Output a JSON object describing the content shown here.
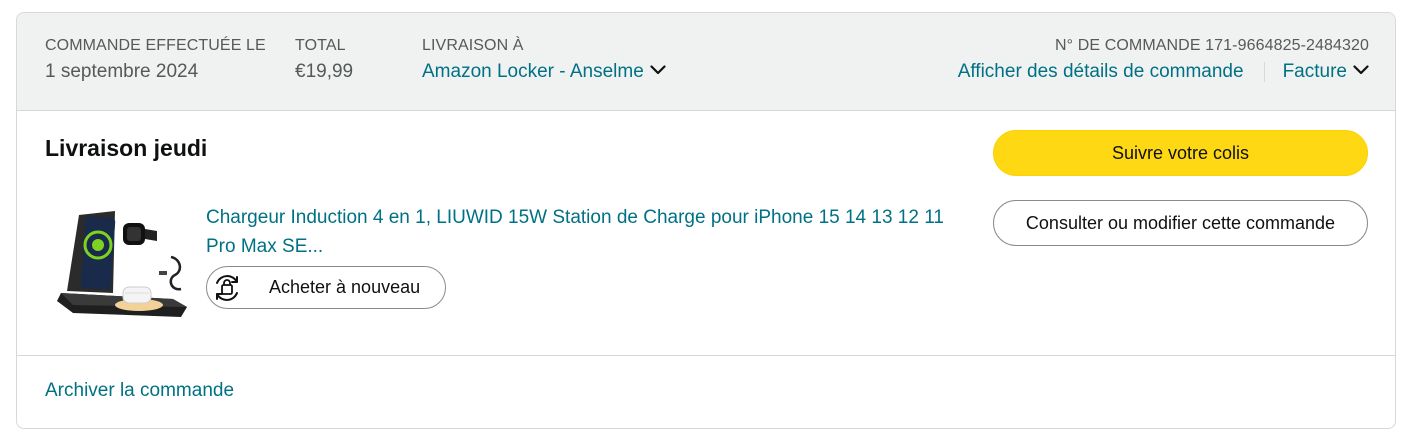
{
  "header": {
    "order_placed_label": "COMMANDE EFFECTUÉE LE",
    "order_placed_value": "1 septembre 2024",
    "total_label": "TOTAL",
    "total_value": "€19,99",
    "ship_to_label": "LIVRAISON À",
    "ship_to_value": "Amazon Locker - Anselme",
    "order_number_label": "N° DE COMMANDE 171-9664825-2484320",
    "order_details_link": "Afficher des détails de commande",
    "invoice_link": "Facture"
  },
  "shipment": {
    "title": "Livraison jeudi",
    "product_title": "Chargeur Induction 4 en 1, LIUWID 15W Station de Charge pour iPhone 15 14 13 12 11 Pro Max SE...",
    "buy_again_label": "Acheter à nouveau",
    "track_label": "Suivre votre colis",
    "modify_label": "Consulter ou modifier cette commande"
  },
  "footer": {
    "archive_link": "Archiver la commande"
  },
  "colors": {
    "link": "#007185",
    "primary_button": "#ffd814",
    "header_bg": "#f0f2f2"
  },
  "icons": {
    "chevron": "chevron-down-icon",
    "buy_again": "buy-again-cycle-icon"
  }
}
